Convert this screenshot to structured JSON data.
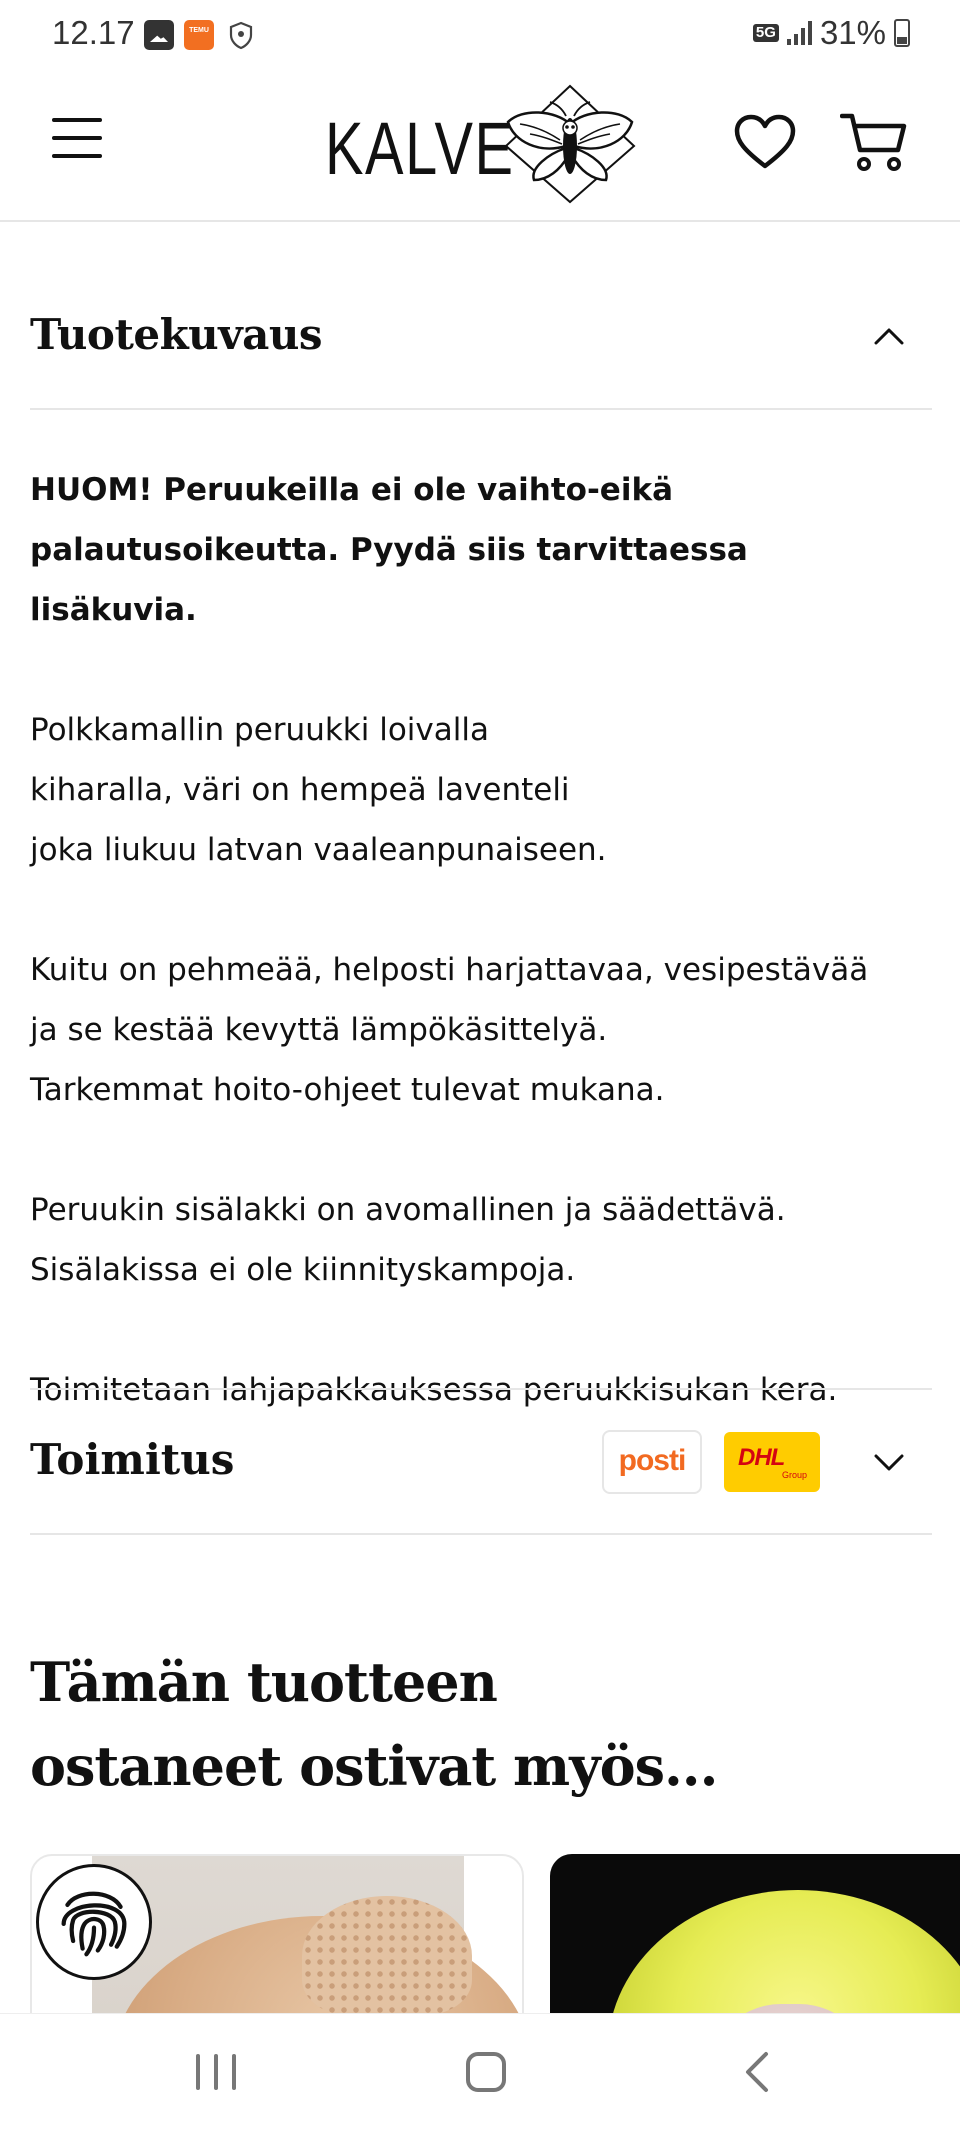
{
  "status_bar": {
    "time": "12.17",
    "network": "5G",
    "battery": "31%",
    "notification_icons": [
      "gallery-icon",
      "temu-icon",
      "shield-icon"
    ],
    "temu_badge": "TEMU"
  },
  "header": {
    "logo_text": "KALVE",
    "icons": [
      "menu-icon",
      "moth-logo-icon",
      "heart-icon",
      "cart-icon"
    ]
  },
  "description_section": {
    "title": "Tuotekuvaus",
    "expanded": true,
    "warning": "HUOM! Peruukeilla ei ole vaihto-eikä palautusoikeutta. Pyydä siis tarvittaessa lisäkuvia.",
    "paragraphs": [
      [
        "Polkkamallin peruukki loivalla",
        "kiharalla, väri on hempeä laventeli",
        "joka liukuu latvan vaaleanpunaiseen."
      ],
      [
        "Kuitu on pehmeää, helposti harjattavaa, vesipestävää",
        "ja se kestää kevyttä lämpökäsittelyä.",
        "Tarkemmat hoito-ohjeet tulevat mukana."
      ],
      [
        "Peruukin sisälakki on avomallinen ja säädettävä.",
        "Sisälakissa ei ole kiinnityskampoja."
      ],
      [
        "Toimitetaan lahjapakkauksessa peruukkisukan kera."
      ]
    ]
  },
  "shipping_section": {
    "title": "Toimitus",
    "expanded": false,
    "carriers": [
      {
        "name": "posti",
        "color": "#f26a21"
      },
      {
        "name": "DHL",
        "sub": "Group",
        "color": "#d40511",
        "background": "#ffcc00"
      }
    ]
  },
  "related": {
    "title_line1": "Tämän tuotteen",
    "title_line2": "ostaneet ostivat myös..."
  },
  "colors": {
    "text": "#111111",
    "divider": "#e6e6e6",
    "background": "#ffffff"
  }
}
